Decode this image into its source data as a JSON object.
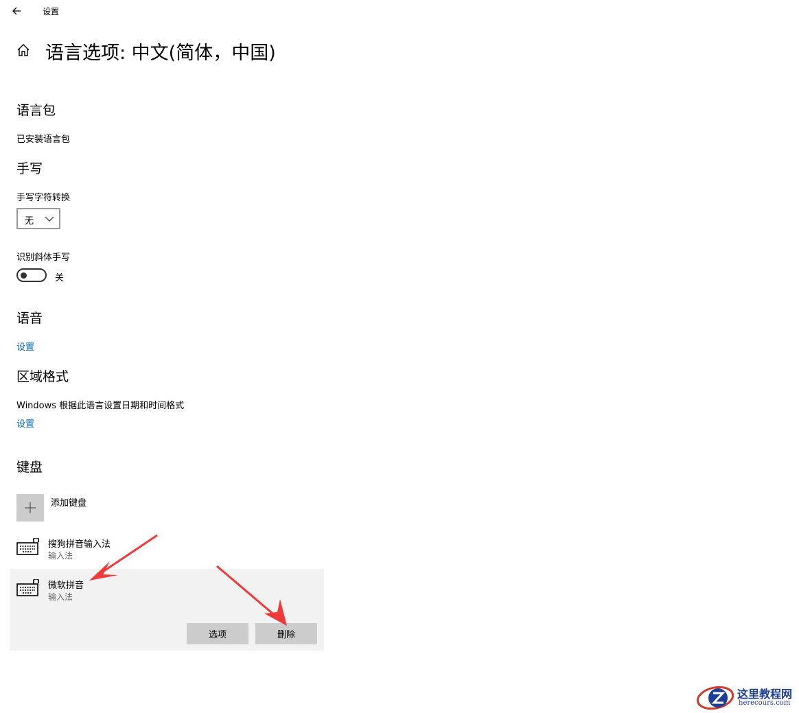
{
  "titlebar": {
    "title": "设置"
  },
  "header": {
    "title": "语言选项: 中文(简体，中国)"
  },
  "language_pack": {
    "heading": "语言包",
    "status": "已安装语言包"
  },
  "handwriting": {
    "heading": "手写",
    "conversion_label": "手写字符转换",
    "conversion_value": "无",
    "italic_label": "识别斜体手写",
    "italic_state": "关"
  },
  "speech": {
    "heading": "语音",
    "settings_link": "设置"
  },
  "region": {
    "heading": "区域格式",
    "description": "Windows 根据此语言设置日期和时间格式",
    "settings_link": "设置"
  },
  "keyboard": {
    "heading": "键盘",
    "add_label": "添加键盘",
    "items": [
      {
        "name": "搜狗拼音输入法",
        "type": "输入法"
      },
      {
        "name": "微软拼音",
        "type": "输入法"
      }
    ],
    "options_button": "选项",
    "remove_button": "删除"
  },
  "watermark": {
    "title": "这里教程网",
    "url": "herecours.com"
  },
  "colors": {
    "link": "#0067c0",
    "selected_bg": "#f2f2f2",
    "button_bg": "#cccccc",
    "annotation_arrow": "#f03a3a",
    "watermark": "#1d3f95"
  }
}
